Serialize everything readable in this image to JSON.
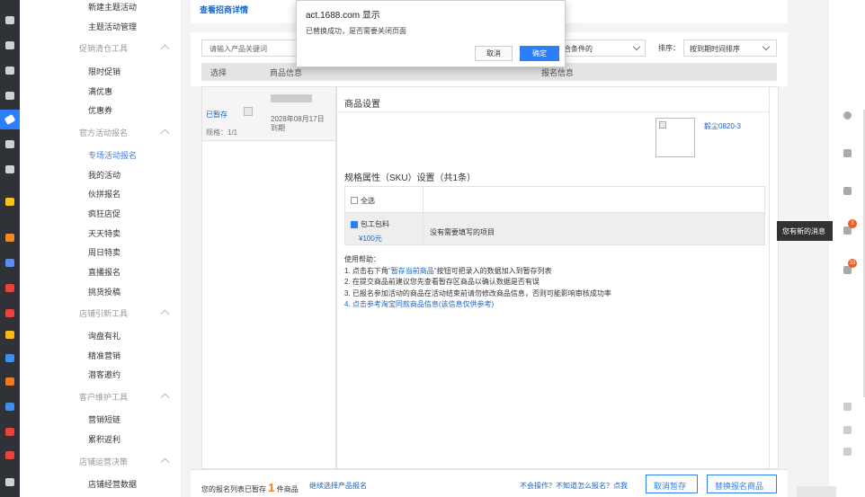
{
  "sidebar": {
    "items": [
      {
        "type": "item",
        "label": "新建主题活动"
      },
      {
        "type": "item",
        "label": "主题活动管理"
      },
      {
        "type": "group",
        "label": "促销清仓工具"
      },
      {
        "type": "item",
        "label": "限时促销"
      },
      {
        "type": "item",
        "label": "满优惠"
      },
      {
        "type": "item",
        "label": "优惠券"
      },
      {
        "type": "group",
        "label": "官方活动报名"
      },
      {
        "type": "item",
        "label": "专场活动报名",
        "active": true
      },
      {
        "type": "item",
        "label": "我的活动"
      },
      {
        "type": "item",
        "label": "伙拼报名"
      },
      {
        "type": "item",
        "label": "疯狂店促"
      },
      {
        "type": "item",
        "label": "天天特卖"
      },
      {
        "type": "item",
        "label": "周日特卖"
      },
      {
        "type": "item",
        "label": "直播报名"
      },
      {
        "type": "item",
        "label": "挑货投稿"
      },
      {
        "type": "group",
        "label": "店铺引新工具"
      },
      {
        "type": "item",
        "label": "询盘有礼"
      },
      {
        "type": "item",
        "label": "精准营销"
      },
      {
        "type": "item",
        "label": "潜客邀约"
      },
      {
        "type": "group",
        "label": "客户维护工具"
      },
      {
        "type": "item",
        "label": "营销短链"
      },
      {
        "type": "item",
        "label": "累积返利"
      },
      {
        "type": "group",
        "label": "店铺运营决策"
      },
      {
        "type": "item",
        "label": "店铺经营数据"
      }
    ]
  },
  "header": {
    "link": "查看招商详情"
  },
  "filters": {
    "keyword_placeholder": "请输入产品关键词",
    "condition_value": "符合条件的",
    "sort_label": "排序：",
    "sort_value": "按到期时间排序"
  },
  "table_headers": {
    "select": "选择",
    "product": "商品信息",
    "signup": "报名信息"
  },
  "product": {
    "status": "已暂存",
    "spec": "规格：1/1",
    "expire_date": "2028年08月17日",
    "expire_suffix": "到期"
  },
  "settings": {
    "title": "商品设置",
    "product_name": "毅尘0820-3",
    "sku_title": "规格属性（SKU）设置（共1条）",
    "select_all": "全选",
    "sku_name": "包工包料",
    "sku_price": "¥100元",
    "sku_note": "没有需要填写的项目",
    "help_title": "使用帮助：",
    "help1_prefix": "1. 点击右下角",
    "help1_quote": "\"暂存当前商品\"",
    "help1_suffix": "按钮可把录入的数据加入到暂存列表",
    "help2": "2. 在提交商品前建议您先查看暂存区商品以确认数据是否有误",
    "help3": "3. 已报名参加活动的商品在活动结束前请勿修改商品信息，否则可能影响审核成功率",
    "help4": "4. 点击参考淘宝同款商品信息(该信息仅供参考)"
  },
  "bottom": {
    "prefix": "您的报名列表已暂存",
    "count": "1",
    "suffix": "件商品",
    "continue": "继续选择产品报名",
    "help": "不会操作？不知道怎么报名？点我",
    "cancel_btn": "取消暂存",
    "replace_btn": "替换报名商品"
  },
  "dialog": {
    "title": "act.1688.com 显示",
    "message": "已替换成功，是否需要关闭页面",
    "cancel": "取消",
    "ok": "确定"
  },
  "tooltip": "您有新的消息",
  "badges": {
    "messages": "3",
    "notices": "33"
  },
  "colors": {
    "accent": "#2d7ff9",
    "link": "#1a64c8",
    "count": "#f07a1e",
    "rail": "#2f3338"
  }
}
